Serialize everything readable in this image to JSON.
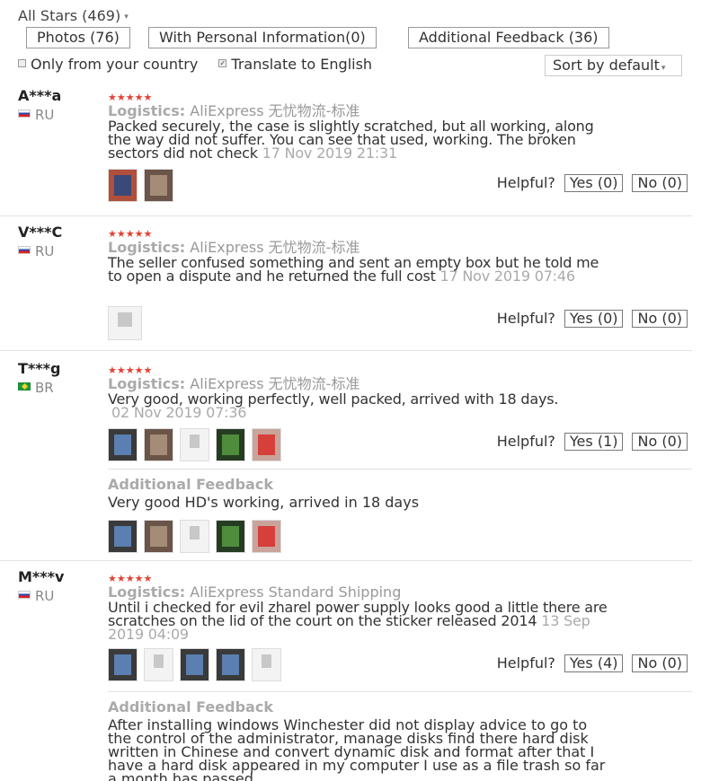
{
  "filters": {
    "all_stars": "All Stars (469)",
    "chips": [
      "Photos (76)",
      "With Personal Information(0)",
      "Additional Feedback (36)"
    ],
    "only_country": "Only from your country",
    "only_country_checked": false,
    "translate": "Translate to English",
    "translate_checked": true,
    "sort": "Sort by default"
  },
  "helpful_label": "Helpful?",
  "additional_feedback_label": "Additional Feedback",
  "reviews": [
    {
      "user": "A***a",
      "country": "RU",
      "stars": "★★★★★",
      "logistics_label": "Logistics:",
      "logistics_value": "AliExpress 无忧物流-标准",
      "text": "Packed securely, the case is slightly scratched, but all working, along the way did not suffer. You can see that used, working. The broken sectors did not check",
      "date": "17 Nov 2019 21:31",
      "yes": "Yes (0)",
      "no": "No (0)"
    },
    {
      "user": "V***C",
      "country": "RU",
      "stars": "★★★★★",
      "logistics_label": "Logistics:",
      "logistics_value": "AliExpress 无忧物流-标准",
      "text": "The seller confused something and sent an empty box but he told me to open a dispute and he returned the full cost",
      "date": "17 Nov 2019 07:46",
      "yes": "Yes (0)",
      "no": "No (0)"
    },
    {
      "user": "T***g",
      "country": "BR",
      "stars": "★★★★★",
      "logistics_label": "Logistics:",
      "logistics_value": "AliExpress 无忧物流-标准",
      "text": "Very good, working perfectly, well packed, arrived with 18 days.",
      "date": "02 Nov 2019 07:36",
      "yes": "Yes (1)",
      "no": "No (0)",
      "additional": "Very good HD's working, arrived in 18 days"
    },
    {
      "user": "M***v",
      "country": "RU",
      "stars": "★★★★★",
      "logistics_label": "Logistics:",
      "logistics_value": "AliExpress Standard Shipping",
      "text": "Until i checked for evil zharel power supply looks good a little there are scratches on the lid of the court on the sticker released 2014",
      "date": "13 Sep 2019 04:09",
      "yes": "Yes (4)",
      "no": "No (0)",
      "additional": "After installing windows Winchester did not display advice to go to the control of the administrator, manage disks find there hard disk written in Chinese and convert dynamic disk and format after that I have a hard disk appeared in my computer I use as a file trash so far a month has passed"
    }
  ]
}
